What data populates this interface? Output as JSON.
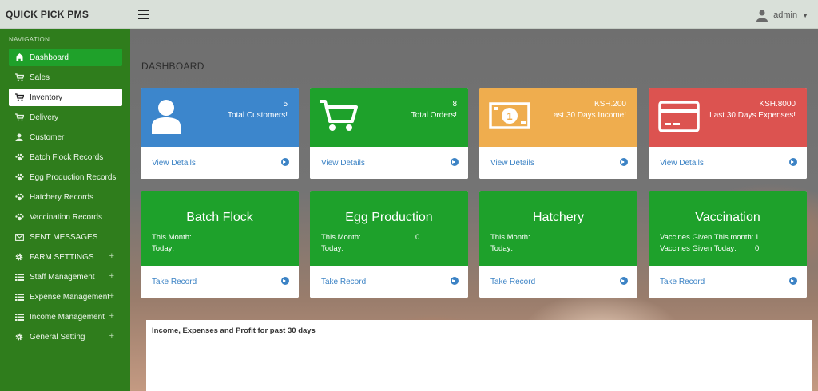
{
  "app": {
    "brand": "QUICK PICK PMS"
  },
  "header": {
    "user_name": "admin"
  },
  "sidebar": {
    "title": "NAVIGATION",
    "items": [
      {
        "label": "Dashboard",
        "icon": "home-icon"
      },
      {
        "label": "Sales",
        "icon": "cart-icon"
      },
      {
        "label": "Inventory",
        "icon": "cart-icon"
      },
      {
        "label": "Delivery",
        "icon": "cart-icon"
      },
      {
        "label": "Customer",
        "icon": "user-icon"
      },
      {
        "label": "Batch Flock Records",
        "icon": "paw-icon"
      },
      {
        "label": "Egg Production Records",
        "icon": "paw-icon"
      },
      {
        "label": "Hatchery Records",
        "icon": "paw-icon"
      },
      {
        "label": "Vaccination Records",
        "icon": "paw-icon"
      },
      {
        "label": "SENT MESSAGES",
        "icon": "envelope-icon"
      },
      {
        "label": "FARM SETTINGS",
        "icon": "gear-icon",
        "expand": "+"
      },
      {
        "label": "Staff Management",
        "icon": "list-icon",
        "expand": "+"
      },
      {
        "label": "Expense Management",
        "icon": "list-icon",
        "expand": "+"
      },
      {
        "label": "Income Management",
        "icon": "list-icon",
        "expand": "+"
      },
      {
        "label": "General Setting",
        "icon": "gear-icon",
        "expand": "+"
      }
    ]
  },
  "main": {
    "title": "DASHBOARD",
    "stats": [
      {
        "value": "5",
        "label": "Total Customers!",
        "link": "View Details",
        "color": "#3c86cc",
        "icon": "user-silhouette-icon"
      },
      {
        "value": "8",
        "label": "Total Orders!",
        "link": "View Details",
        "color": "#1ea12b",
        "icon": "shopping-cart-icon"
      },
      {
        "value": "KSH.200",
        "label": "Last 30 Days Income!",
        "link": "View Details",
        "color": "#efad4e",
        "icon": "banknote-icon"
      },
      {
        "value": "KSH.8000",
        "label": "Last 30 Days Expenses!",
        "link": "View Details",
        "color": "#dc5350",
        "icon": "credit-card-icon"
      }
    ],
    "records": [
      {
        "title": "Batch Flock",
        "row1": "This Month:",
        "row2": "Today:",
        "val1": "",
        "val2": "",
        "link": "Take Record"
      },
      {
        "title": "Egg Production",
        "row1": "This Month:",
        "row2": "Today:",
        "val1": "0",
        "val2": "",
        "link": "Take Record"
      },
      {
        "title": "Hatchery",
        "row1": "This Month:",
        "row2": "Today:",
        "val1": "",
        "val2": "",
        "link": "Take Record"
      },
      {
        "title": "Vaccination",
        "row1": "Vaccines Given This month:",
        "row2": "Vaccines Given Today:",
        "val1": "1",
        "val2": "0",
        "link": "Take Record"
      }
    ],
    "panel_title": "Income, Expenses and Profit for past 30 days"
  }
}
